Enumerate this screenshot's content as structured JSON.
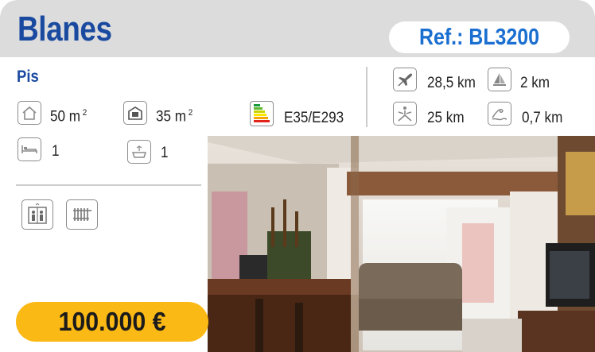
{
  "header": {
    "town": "Blanes",
    "reference": "Ref.: BL3200"
  },
  "property": {
    "type": "Pis",
    "built_area": "50 m",
    "built_area_sup": "2",
    "useful_area": "35  m",
    "useful_area_sup": "2",
    "energy_rating": "E35/E293",
    "bedrooms": "1",
    "bathrooms": "1",
    "amenities": [
      "elevator-icon",
      "radiator-icon"
    ]
  },
  "distances": {
    "airport": "28,5 km",
    "port": "2 km",
    "ski": "25 km",
    "beach": "0,7 km"
  },
  "price": "100.000 €",
  "colors": {
    "title_blue": "#1a4aa0",
    "ref_blue": "#1a6fd0",
    "header_gray": "#dcdcdc",
    "price_yellow": "#fbb915"
  }
}
